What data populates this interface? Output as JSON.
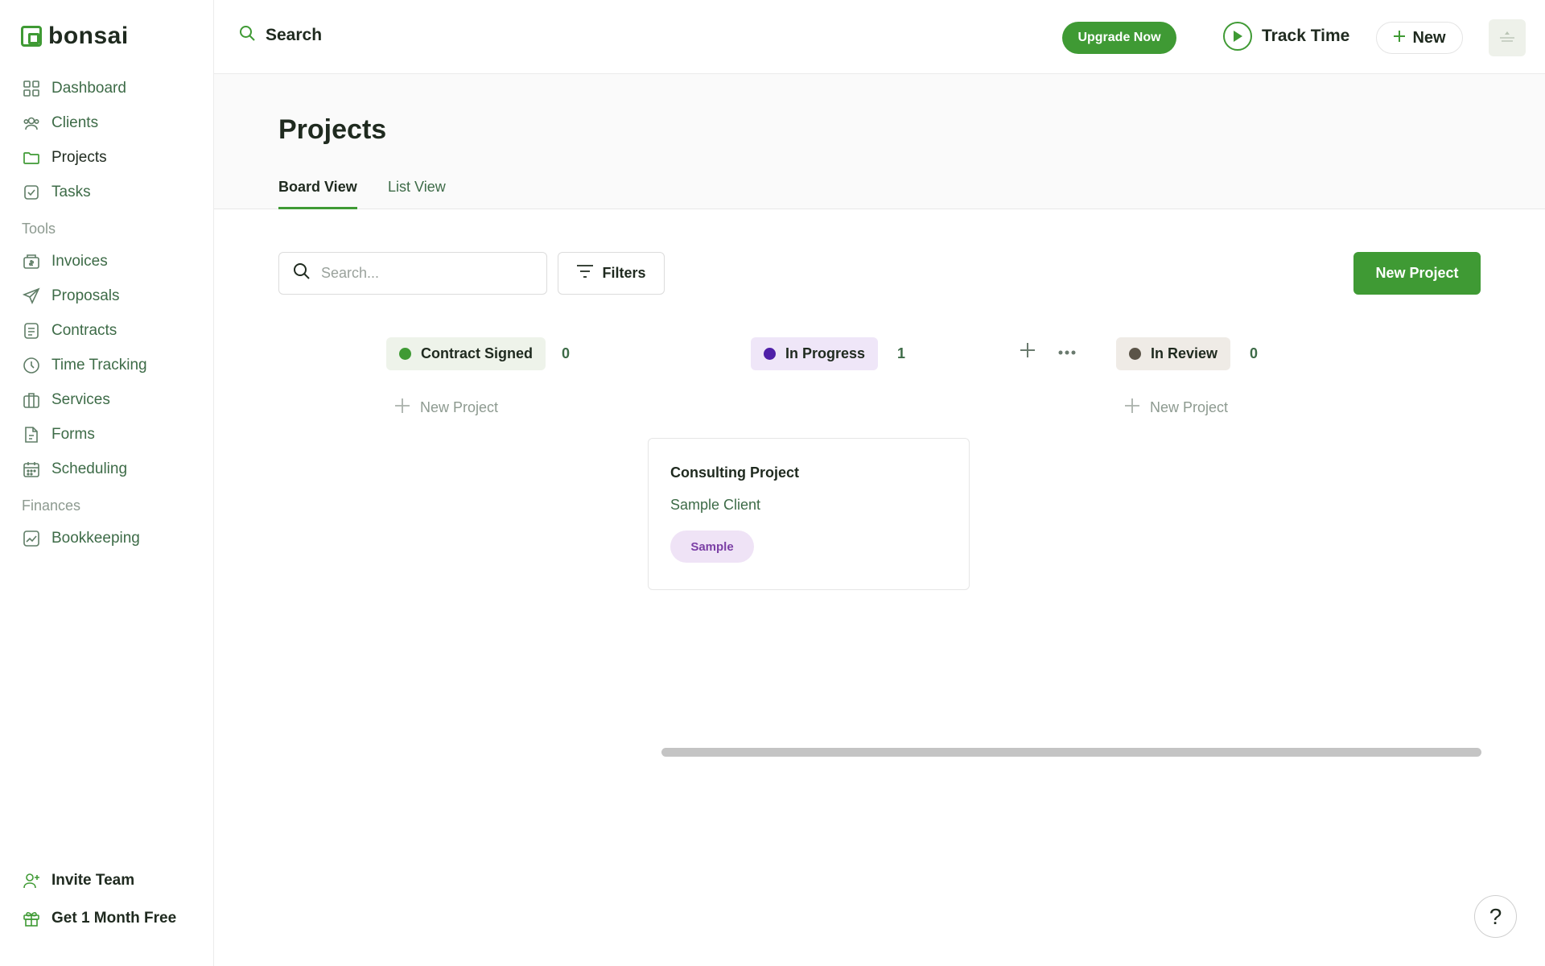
{
  "app": {
    "logo_text": "bonsai"
  },
  "sidebar": {
    "items": [
      {
        "label": "Dashboard",
        "icon": "grid-icon"
      },
      {
        "label": "Clients",
        "icon": "users-icon"
      },
      {
        "label": "Projects",
        "icon": "folder-icon",
        "active": true
      },
      {
        "label": "Tasks",
        "icon": "checkbox-icon"
      }
    ],
    "tools_label": "Tools",
    "tools": [
      {
        "label": "Invoices",
        "icon": "invoice-icon"
      },
      {
        "label": "Proposals",
        "icon": "send-icon"
      },
      {
        "label": "Contracts",
        "icon": "document-icon"
      },
      {
        "label": "Time Tracking",
        "icon": "clock-icon"
      },
      {
        "label": "Services",
        "icon": "briefcase-icon"
      },
      {
        "label": "Forms",
        "icon": "form-icon"
      },
      {
        "label": "Scheduling",
        "icon": "calendar-icon"
      }
    ],
    "finances_label": "Finances",
    "finances": [
      {
        "label": "Bookkeeping",
        "icon": "chart-icon"
      }
    ],
    "bottom": [
      {
        "label": "Invite Team",
        "icon": "user-plus-icon"
      },
      {
        "label": "Get 1 Month Free",
        "icon": "gift-icon"
      }
    ]
  },
  "topbar": {
    "search_label": "Search",
    "upgrade_label": "Upgrade Now",
    "track_time_label": "Track Time",
    "new_label": "New"
  },
  "page": {
    "title": "Projects",
    "tabs": [
      {
        "label": "Board View",
        "active": true
      },
      {
        "label": "List View",
        "active": false
      }
    ]
  },
  "toolbar": {
    "search_placeholder": "Search...",
    "filters_label": "Filters",
    "new_project_label": "New Project"
  },
  "board": {
    "columns": [
      {
        "name": "Contract Signed",
        "count": "0",
        "dot_color": "#3f9a34",
        "pill_bg": "#eef3ea",
        "new_label": "New Project"
      },
      {
        "name": "In Progress",
        "count": "1",
        "dot_color": "#4f1fa8",
        "pill_bg": "#efe6f8"
      },
      {
        "name": "In Review",
        "count": "0",
        "dot_color": "#5b5448",
        "pill_bg": "#efebe6",
        "new_label": "New Project"
      }
    ],
    "card": {
      "title": "Consulting Project",
      "client": "Sample Client",
      "tag": "Sample"
    }
  },
  "help": {
    "label": "?"
  },
  "colors": {
    "accent": "#3f9a34",
    "muted_green": "#3d6b47"
  }
}
